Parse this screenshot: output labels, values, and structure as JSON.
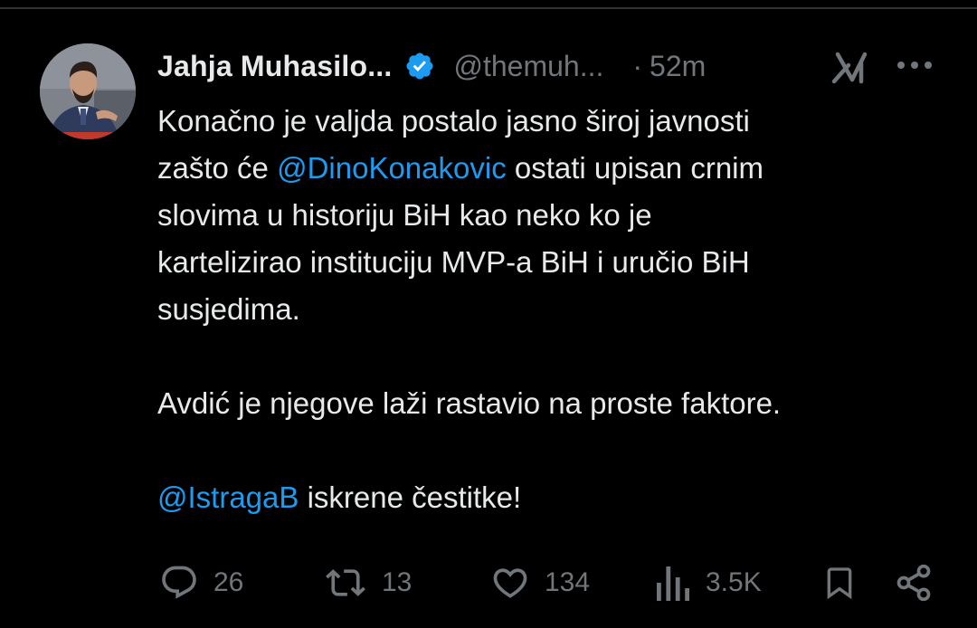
{
  "tweet": {
    "display_name": "Jahja Muhasilo...",
    "handle": "@themuh...",
    "separator": "·",
    "time": "52m",
    "body": {
      "line1_prefix": "Konačno je valjda postalo jasno široj javnosti",
      "line2_prefix": "zašto će ",
      "mention1": "@DinoKonakovic",
      "line2_rest": " ostati upisan crnim",
      "line3": "slovima u historiju BiH kao neko ko je",
      "line4": "kartelizirao instituciju MVP-a BiH i uručio BiH",
      "line5": "susjedima.",
      "para2": "Avdić je njegove laži rastavio na proste faktore.",
      "mention2": "@IstragaB",
      "para3_rest": " iskrene čestitke!"
    },
    "actions": {
      "replies": "26",
      "reposts": "13",
      "likes": "134",
      "views": "3.5K"
    }
  },
  "icons": {
    "verified": "verified-badge-icon",
    "grok": "grok-icon",
    "more": "more-dots-icon",
    "reply": "reply-bubble-icon",
    "repost": "repost-arrows-icon",
    "like": "heart-icon",
    "views": "views-bar-chart-icon",
    "bookmark": "bookmark-icon",
    "share": "share-icon"
  },
  "colors": {
    "background": "#000000",
    "text": "#e7e9ea",
    "muted": "#71767b",
    "accent": "#1d9bf0"
  }
}
